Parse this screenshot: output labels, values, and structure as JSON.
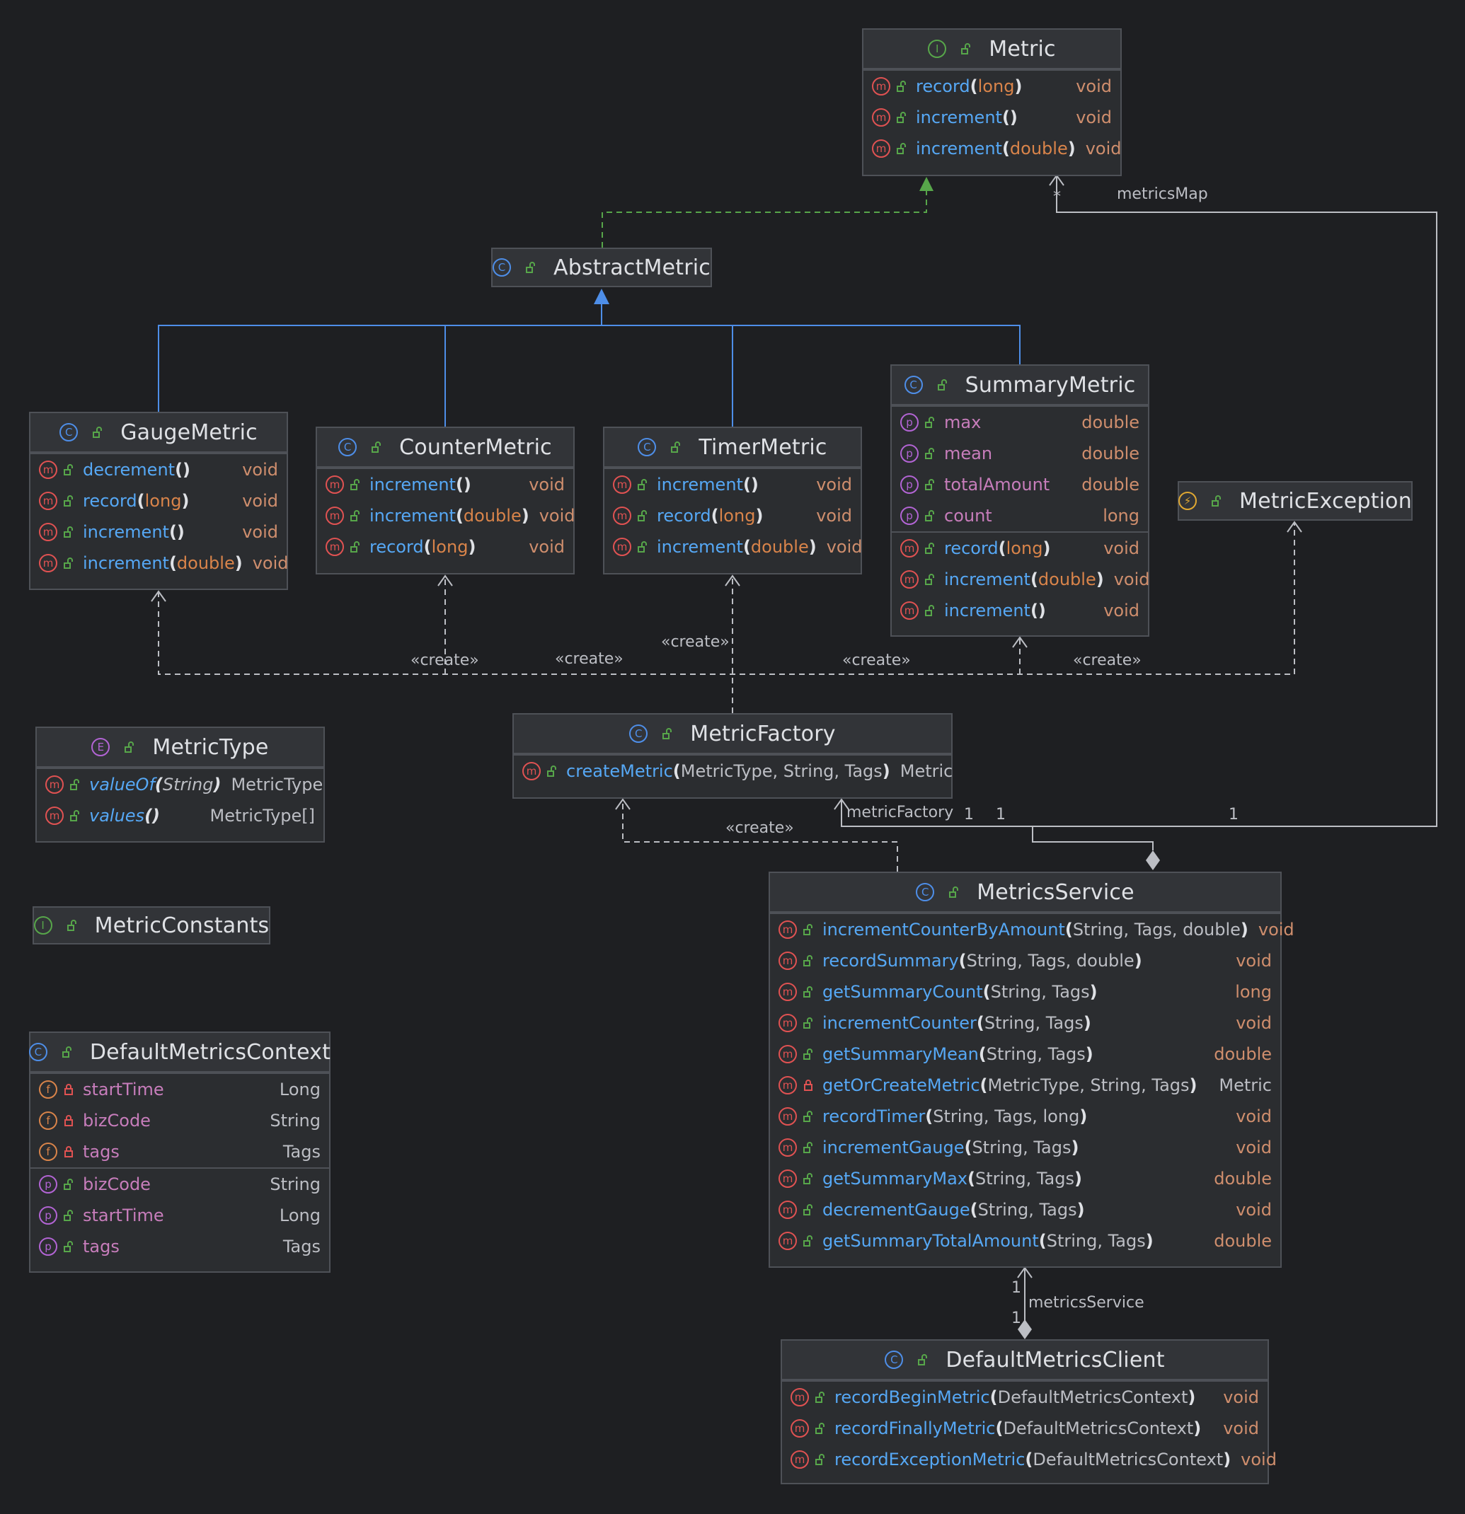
{
  "colors": {
    "background": "#1e1f22",
    "node_fill": "#2b2d30",
    "method_name": "#56a8f5",
    "property_name": "#c77dbb",
    "return_keyword": "#cf8e6d",
    "inheritance_edge": "#4e8ee8",
    "realization_edge": "#57a64a",
    "dependency_edge": "#bcbec4"
  },
  "nodes": {
    "metric": {
      "kind": "I",
      "title": "Metric",
      "sections": [
        [
          {
            "k": "m",
            "name": "record",
            "params": "long",
            "ret": "void"
          },
          {
            "k": "m",
            "name": "increment",
            "params": "",
            "ret": "void"
          },
          {
            "k": "m",
            "name": "increment",
            "params": "double",
            "ret": "void"
          }
        ]
      ]
    },
    "abstract_metric": {
      "kind": "C",
      "title": "AbstractMetric",
      "sections": []
    },
    "gauge_metric": {
      "kind": "C",
      "title": "GaugeMetric",
      "sections": [
        [
          {
            "k": "m",
            "name": "decrement",
            "params": "",
            "ret": "void"
          },
          {
            "k": "m",
            "name": "record",
            "params": "long",
            "ret": "void"
          },
          {
            "k": "m",
            "name": "increment",
            "params": "",
            "ret": "void"
          },
          {
            "k": "m",
            "name": "increment",
            "params": "double",
            "ret": "void"
          }
        ]
      ]
    },
    "counter_metric": {
      "kind": "C",
      "title": "CounterMetric",
      "sections": [
        [
          {
            "k": "m",
            "name": "increment",
            "params": "",
            "ret": "void"
          },
          {
            "k": "m",
            "name": "increment",
            "params": "double",
            "ret": "void"
          },
          {
            "k": "m",
            "name": "record",
            "params": "long",
            "ret": "void"
          }
        ]
      ]
    },
    "timer_metric": {
      "kind": "C",
      "title": "TimerMetric",
      "sections": [
        [
          {
            "k": "m",
            "name": "increment",
            "params": "",
            "ret": "void"
          },
          {
            "k": "m",
            "name": "record",
            "params": "long",
            "ret": "void"
          },
          {
            "k": "m",
            "name": "increment",
            "params": "double",
            "ret": "void"
          }
        ]
      ]
    },
    "summary_metric": {
      "kind": "C",
      "title": "SummaryMetric",
      "sections": [
        [
          {
            "k": "p",
            "name": "max",
            "ret": "double"
          },
          {
            "k": "p",
            "name": "mean",
            "ret": "double"
          },
          {
            "k": "p",
            "name": "totalAmount",
            "ret": "double"
          },
          {
            "k": "p",
            "name": "count",
            "ret": "long"
          }
        ],
        [
          {
            "k": "m",
            "name": "record",
            "params": "long",
            "ret": "void"
          },
          {
            "k": "m",
            "name": "increment",
            "params": "double",
            "ret": "void"
          },
          {
            "k": "m",
            "name": "increment",
            "params": "",
            "ret": "void"
          }
        ]
      ]
    },
    "metric_exception": {
      "kind": "X",
      "title": "MetricException",
      "sections": []
    },
    "metric_type": {
      "kind": "E",
      "title": "MetricType",
      "sections": [
        [
          {
            "k": "m",
            "name": "valueOf",
            "params": "String",
            "ret": "MetricType",
            "italic": true
          },
          {
            "k": "m",
            "name": "values",
            "params": "",
            "ret": "MetricType[]",
            "italic": true
          }
        ]
      ]
    },
    "metric_factory": {
      "kind": "C",
      "title": "MetricFactory",
      "sections": [
        [
          {
            "k": "m",
            "name": "createMetric",
            "params": "MetricType, String, Tags",
            "ret": "Metric"
          }
        ]
      ]
    },
    "metric_constants": {
      "kind": "I",
      "title": "MetricConstants",
      "sections": []
    },
    "default_metrics_context": {
      "kind": "C",
      "title": "DefaultMetricsContext",
      "sections": [
        [
          {
            "k": "f",
            "vis": "private",
            "name": "startTime",
            "ret": "Long"
          },
          {
            "k": "f",
            "vis": "private",
            "name": "bizCode",
            "ret": "String"
          },
          {
            "k": "f",
            "vis": "private",
            "name": "tags",
            "ret": "Tags"
          }
        ],
        [
          {
            "k": "p",
            "name": "bizCode",
            "ret": "String"
          },
          {
            "k": "p",
            "name": "startTime",
            "ret": "Long"
          },
          {
            "k": "p",
            "name": "tags",
            "ret": "Tags"
          }
        ]
      ]
    },
    "metrics_service": {
      "kind": "C",
      "title": "MetricsService",
      "sections": [
        [
          {
            "k": "m",
            "name": "incrementCounterByAmount",
            "params": "String, Tags, double",
            "ret": "void"
          },
          {
            "k": "m",
            "name": "recordSummary",
            "params": "String, Tags, double",
            "ret": "void"
          },
          {
            "k": "m",
            "name": "getSummaryCount",
            "params": "String, Tags",
            "ret": "long"
          },
          {
            "k": "m",
            "name": "incrementCounter",
            "params": "String, Tags",
            "ret": "void"
          },
          {
            "k": "m",
            "name": "getSummaryMean",
            "params": "String, Tags",
            "ret": "double"
          },
          {
            "k": "m",
            "vis": "private",
            "name": "getOrCreateMetric",
            "params": "MetricType, String, Tags",
            "ret": "Metric"
          },
          {
            "k": "m",
            "name": "recordTimer",
            "params": "String, Tags, long",
            "ret": "void"
          },
          {
            "k": "m",
            "name": "incrementGauge",
            "params": "String, Tags",
            "ret": "void"
          },
          {
            "k": "m",
            "name": "getSummaryMax",
            "params": "String, Tags",
            "ret": "double"
          },
          {
            "k": "m",
            "name": "decrementGauge",
            "params": "String, Tags",
            "ret": "void"
          },
          {
            "k": "m",
            "name": "getSummaryTotalAmount",
            "params": "String, Tags",
            "ret": "double"
          }
        ]
      ]
    },
    "default_metrics_client": {
      "kind": "C",
      "title": "DefaultMetricsClient",
      "sections": [
        [
          {
            "k": "m",
            "name": "recordBeginMetric",
            "params": "DefaultMetricsContext",
            "ret": "void"
          },
          {
            "k": "m",
            "name": "recordFinallyMetric",
            "params": "DefaultMetricsContext",
            "ret": "void"
          },
          {
            "k": "m",
            "name": "recordExceptionMetric",
            "params": "DefaultMetricsContext",
            "ret": "void"
          }
        ]
      ]
    }
  },
  "edge_labels": {
    "create": "«create»",
    "metrics_map": "metricsMap",
    "metric_factory": "metricFactory",
    "metrics_service": "metricsService",
    "mult_1": "1",
    "mult_star": "*"
  }
}
